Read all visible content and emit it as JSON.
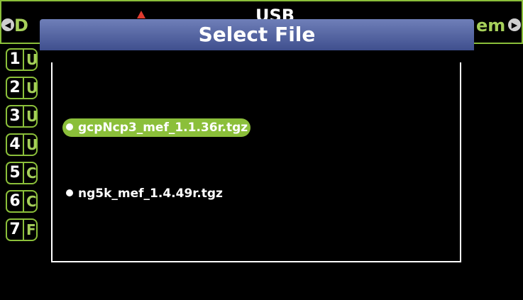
{
  "background": {
    "title_left": "D",
    "title_center": "USB",
    "title_right": "em",
    "menu": [
      {
        "number": "1",
        "letter": "U"
      },
      {
        "number": "2",
        "letter": "U"
      },
      {
        "number": "3",
        "letter": "U"
      },
      {
        "number": "4",
        "letter": "U"
      },
      {
        "number": "5",
        "letter": "C"
      },
      {
        "number": "6",
        "letter": "C"
      },
      {
        "number": "7",
        "letter": "F"
      }
    ]
  },
  "dialog": {
    "title": "Select File",
    "files": [
      {
        "name": "gcpNcp3_mef_1.1.36r.tgz",
        "selected": true
      },
      {
        "name": "ng5k_mef_1.4.49r.tgz",
        "selected": false
      }
    ]
  },
  "colors": {
    "accent_green": "#8bbf3a",
    "title_bar_blue": "#4f5f9e",
    "alert_red": "#e03b2f"
  }
}
